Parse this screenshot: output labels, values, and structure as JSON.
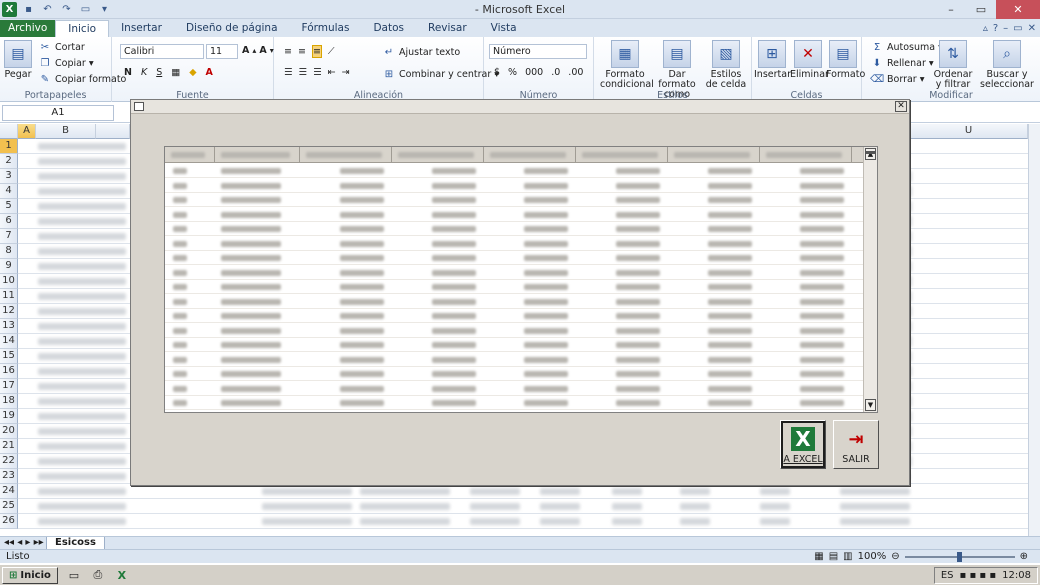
{
  "window": {
    "title": "- Microsoft Excel"
  },
  "tabs": [
    "Archivo",
    "Inicio",
    "Insertar",
    "Diseño de página",
    "Fórmulas",
    "Datos",
    "Revisar",
    "Vista"
  ],
  "ribbon": {
    "clipboard": {
      "paste": "Pegar",
      "cut": "Cortar",
      "copy": "Copiar",
      "format_painter": "Copiar formato",
      "label": "Portapapeles"
    },
    "font": {
      "name": "Calibri",
      "size": "11",
      "label": "Fuente"
    },
    "alignment": {
      "wrap": "Ajustar texto",
      "merge": "Combinar y centrar",
      "label": "Alineación"
    },
    "number": {
      "format": "Número",
      "label": "Número"
    },
    "styles": {
      "conditional": "Formato condicional",
      "as_table": "Dar formato como tabla",
      "cell_styles": "Estilos de celda",
      "label": "Estilos"
    },
    "cells": {
      "insert": "Insertar",
      "delete": "Eliminar",
      "format": "Formato",
      "label": "Celdas"
    },
    "editing": {
      "autosum": "Autosuma",
      "fill": "Rellenar",
      "clear": "Borrar",
      "sort": "Ordenar y filtrar",
      "find": "Buscar y seleccionar",
      "label": "Modificar"
    }
  },
  "formula_bar": {
    "name_box": "A1"
  },
  "grid": {
    "col_a": "A",
    "col_b": "B",
    "col_u": "U",
    "rows": [
      "1",
      "2",
      "3",
      "4",
      "5",
      "6",
      "7",
      "8",
      "9",
      "10",
      "11",
      "12",
      "13",
      "14",
      "15",
      "16",
      "17",
      "18",
      "19",
      "20",
      "21",
      "22",
      "23",
      "24",
      "25",
      "26"
    ]
  },
  "sheet": {
    "tab": "Esicoss"
  },
  "status": {
    "text": "Listo",
    "zoom": "100%"
  },
  "dialog": {
    "export_label": "A EXCEL",
    "exit_label": "SALIR",
    "row_count": 17
  },
  "taskbar": {
    "start": "Inicio",
    "lang": "ES",
    "clock": "12:08"
  }
}
